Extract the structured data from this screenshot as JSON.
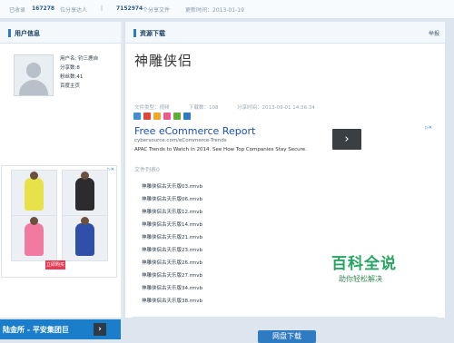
{
  "topbar": {
    "included_label": "已收录",
    "included_count": "167278",
    "sharers_label": "位分享达人",
    "separator": "|",
    "files_count": "7152974",
    "files_label": "个分享文件",
    "updated": "更新时间：2013-01-19"
  },
  "sidebar": {
    "title": "用户信息",
    "user": {
      "name": "用户名: 钓三鹿自",
      "shares": "分享数:8",
      "fans": "粉丝数:41",
      "homepage": "百度主页"
    },
    "ad": {
      "marker": "▷✕",
      "button": "立即购买"
    },
    "banner": {
      "text": "陆金所 - 平安集团巨",
      "arrow": "›"
    }
  },
  "main": {
    "title": "资源下载",
    "report": "举报",
    "resource_title": "神雕侠侣",
    "meta": {
      "type": "文件类型：视频",
      "downloads": "下载数：108",
      "share_time": "分享时间：2013-09-01 14:36:34"
    },
    "ad": {
      "headline": "Free eCommerce Report",
      "url": "cybersource.com/eCommerce-Trends",
      "description": "APAC Trends to Watch in 2014. See How Top Companies Stay Secure.",
      "arrow": "›",
      "marker": "▷✕"
    },
    "files_header": "文件列表0",
    "files": [
      "神雕侠侣古天乐版03.rmvb",
      "神雕侠侣古天乐版06.rmvb",
      "神雕侠侣古天乐版12.rmvb",
      "神雕侠侣古天乐版14.rmvb",
      "神雕侠侣古天乐版21.rmvb",
      "神雕侠侣古天乐版23.rmvb",
      "神雕侠侣古天乐版26.rmvb",
      "神雕侠侣古天乐版27.rmvb",
      "神雕侠侣古天乐版34.rmvb",
      "神雕侠侣古天乐版38.rmvb"
    ],
    "download_button": "网盘下载"
  },
  "watermark": {
    "main": "百科全说",
    "sub": "助你轻松解决"
  },
  "colors": {
    "accent": "#2f7bc2",
    "watermark": "#27a560",
    "ad_headline": "#1a4fb0"
  }
}
